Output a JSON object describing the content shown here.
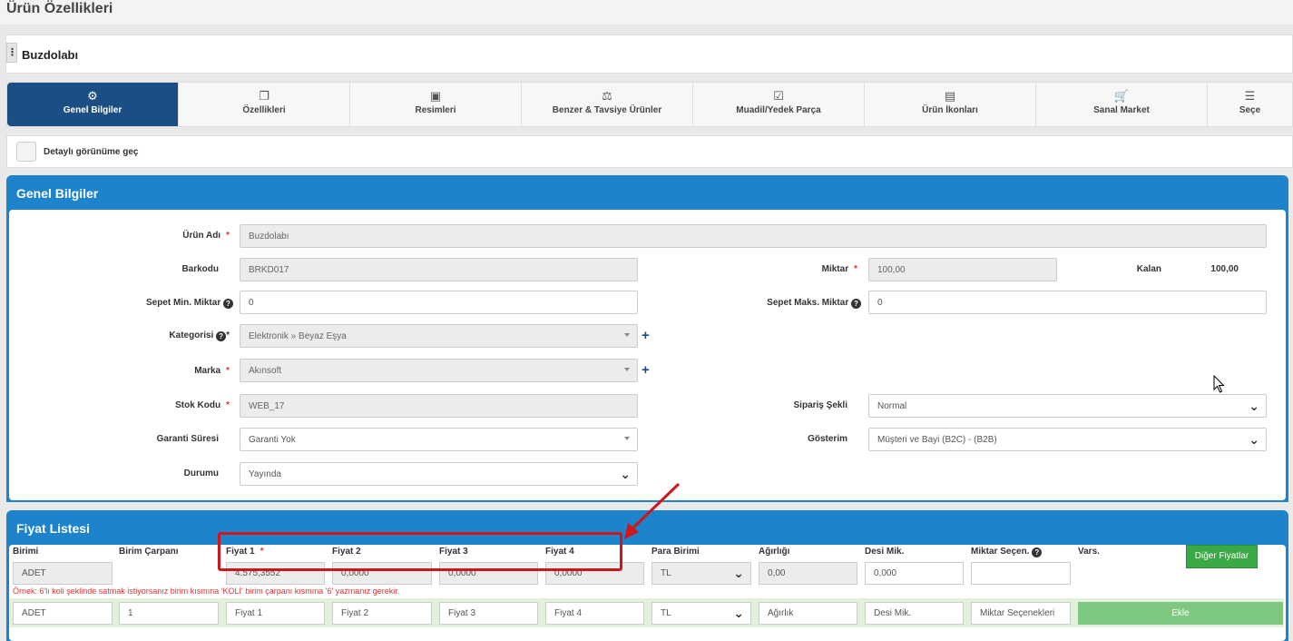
{
  "page": {
    "title": "Ürün Özellikleri"
  },
  "product": {
    "name": "Buzdolabı"
  },
  "tabs": [
    {
      "label": "Genel Bilgiler",
      "icon": "gears-icon",
      "glyph": "⚙"
    },
    {
      "label": "Özellikleri",
      "icon": "copy-icon",
      "glyph": "❐"
    },
    {
      "label": "Resimleri",
      "icon": "image-icon",
      "glyph": "▣"
    },
    {
      "label": "Benzer & Tavsiye Ürünler",
      "icon": "balance-scale-icon",
      "glyph": "⚖"
    },
    {
      "label": "Muadil/Yedek Parça",
      "icon": "check-square-icon",
      "glyph": "☑"
    },
    {
      "label": "Ürün İkonları",
      "icon": "file-image-icon",
      "glyph": "▤"
    },
    {
      "label": "Sanal Market",
      "icon": "cart-icon",
      "glyph": "🛒"
    },
    {
      "label": "Seçe",
      "icon": "list-icon",
      "glyph": "☰"
    }
  ],
  "detail_toggle": {
    "label": "Detaylı görünüme geç"
  },
  "general": {
    "title": "Genel Bilgiler",
    "fields": {
      "urun_adi": {
        "label": "Ürün Adı",
        "value": "Buzdolabı"
      },
      "barkodu": {
        "label": "Barkodu",
        "value": "BRKD017"
      },
      "miktar": {
        "label": "Miktar",
        "value": "100,00"
      },
      "kalan": {
        "label": "Kalan",
        "value": "100,00"
      },
      "sepet_min": {
        "label": "Sepet Min. Miktar",
        "value": "0"
      },
      "sepet_maks": {
        "label": "Sepet Maks. Miktar",
        "value": "0"
      },
      "kategori": {
        "label": "Kategorisi",
        "value": "Elektronik » Beyaz Eşya"
      },
      "marka": {
        "label": "Marka",
        "value": "Akınsoft"
      },
      "stok_kodu": {
        "label": "Stok Kodu",
        "value": "WEB_17"
      },
      "siparis_sekli": {
        "label": "Sipariş Şekli",
        "value": "Normal"
      },
      "garanti": {
        "label": "Garanti Süresi",
        "value": "Garanti Yok"
      },
      "gosterim": {
        "label": "Gösterim",
        "value": "Müşteri ve Bayi (B2C) - (B2B)"
      },
      "durum": {
        "label": "Durumu",
        "value": "Yayında"
      }
    }
  },
  "price_list": {
    "title": "Fiyat Listesi",
    "columns": {
      "birimi": "Birimi",
      "carpan": "Birim Çarpanı",
      "fiyat1": "Fiyat 1",
      "fiyat2": "Fiyat 2",
      "fiyat3": "Fiyat 3",
      "fiyat4": "Fiyat 4",
      "para": "Para Birimi",
      "agirlik": "Ağırlığı",
      "desi": "Desi Mik.",
      "miktar_secen": "Miktar Seçen.",
      "vars": "Vars."
    },
    "row": {
      "birimi": "ADET",
      "fiyat1": "4.575,3552",
      "fiyat2": "0,0000",
      "fiyat3": "0,0000",
      "fiyat4": "0,0000",
      "para": "TL",
      "agirlik": "0,00",
      "desi": "0,000",
      "miktar_secen": ""
    },
    "other_prices_button": "Diğer Fiyatlar",
    "note": "Örnek: 6'lı koli şeklinde satmak istiyorsanız birim kısmına 'KOLİ' birim çarpanı kısmına '6' yazmanız gerekir.",
    "new_row": {
      "birimi": "ADET",
      "carpan": "1",
      "fiyat1_ph": "Fiyat 1",
      "fiyat2_ph": "Fiyat 2",
      "fiyat3_ph": "Fiyat 3",
      "fiyat4_ph": "Fiyat 4",
      "para": "TL",
      "agirlik_ph": "Ağırlık",
      "desi_ph": "Desi Mik.",
      "miktar_ph": "Miktar Seçenekleri",
      "add_button": "Ekle"
    }
  },
  "colors": {
    "primary": "#1c4e86",
    "panel": "#1d84cc",
    "success": "#3aa845",
    "annotation": "#d0161a"
  }
}
